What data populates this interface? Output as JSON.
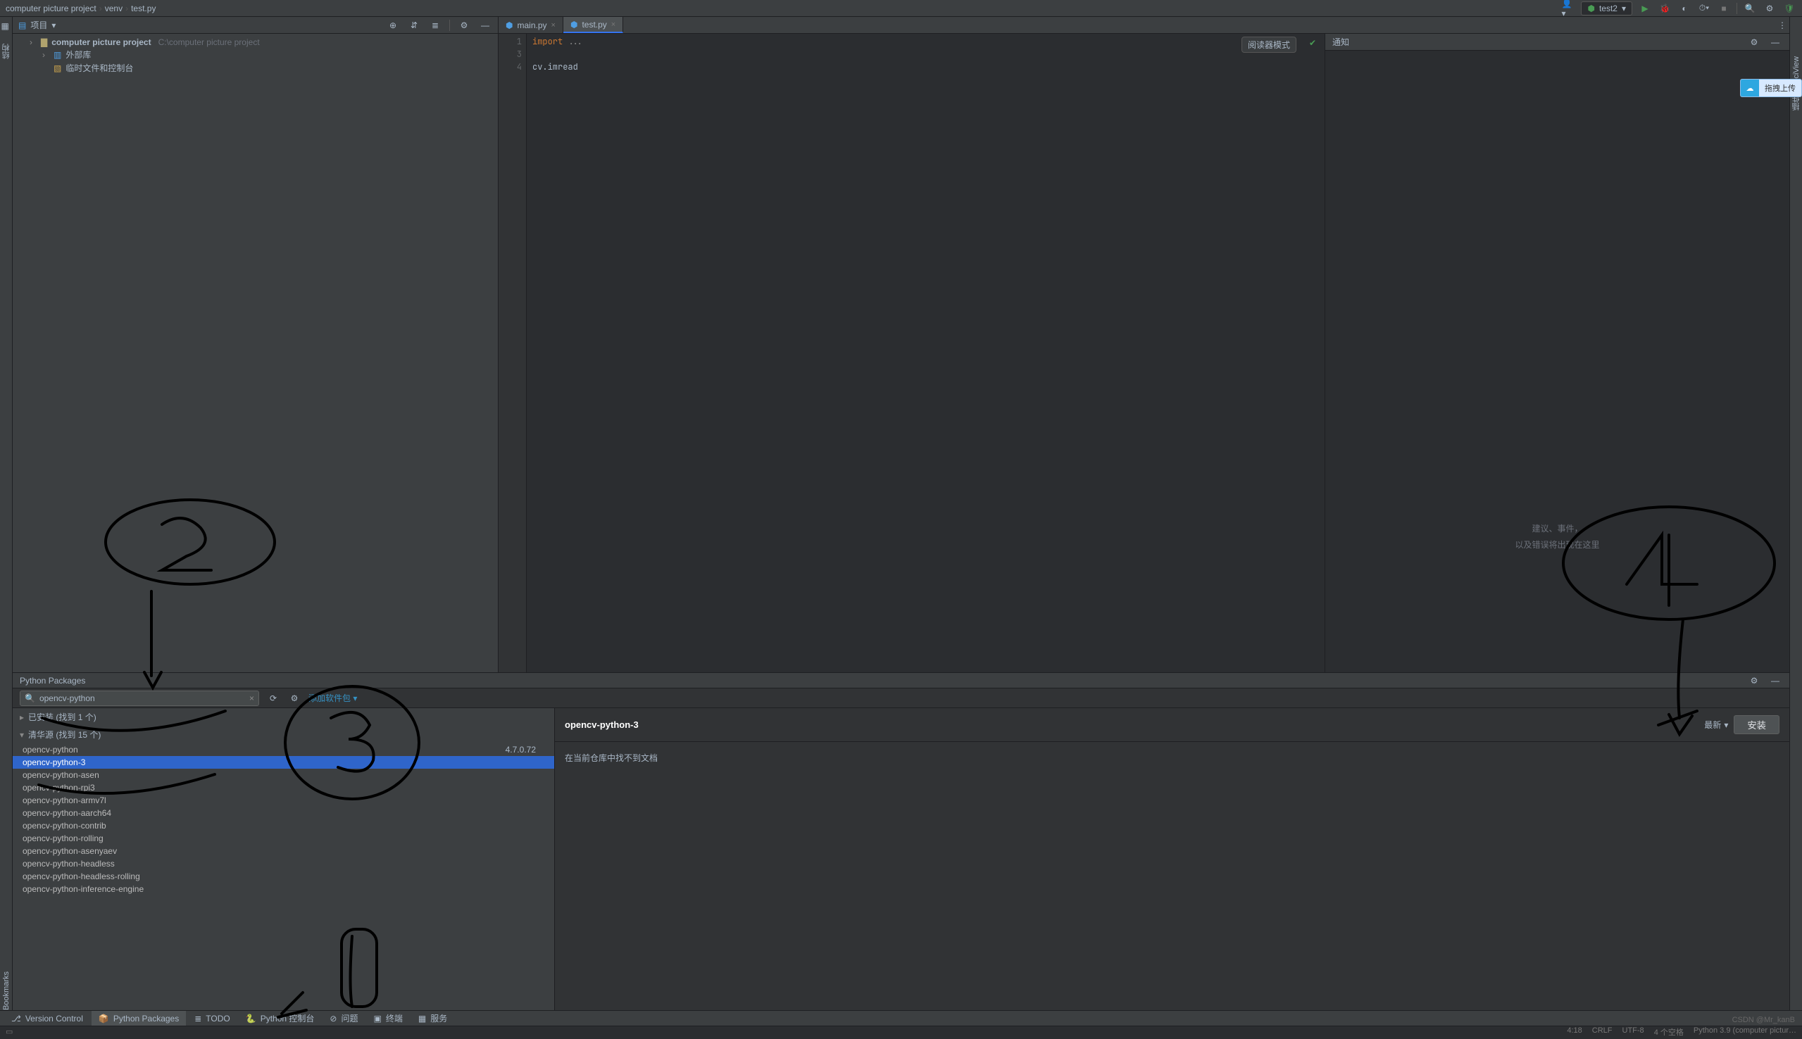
{
  "breadcrumbs": [
    "computer picture project",
    "venv",
    "test.py"
  ],
  "run_config": {
    "name": "test2"
  },
  "project_tool": {
    "title": "项目",
    "root": {
      "name": "computer picture project",
      "path": "C:\\computer picture project"
    },
    "items": [
      {
        "label": "外部库"
      },
      {
        "label": "临时文件和控制台"
      }
    ]
  },
  "editor": {
    "tabs": [
      {
        "label": "main.py",
        "active": false
      },
      {
        "label": "test.py",
        "active": true
      }
    ],
    "reader_mode": "阅读器模式",
    "lines": [
      {
        "n": 1,
        "html": "<span class='kw'>import</span> <span class='dim'>...</span>"
      },
      {
        "n": 3,
        "html": ""
      },
      {
        "n": 4,
        "html": "cv.imread"
      }
    ]
  },
  "notifications": {
    "title": "通知",
    "empty_line1": "建议、事件，",
    "empty_line2": "以及错误将出现在这里"
  },
  "side_right": {
    "tab1": "SciView",
    "tab2": "插件"
  },
  "upload_badge": "拖拽上传",
  "left_gutter": {
    "tab1": "结构",
    "tab2": "Bookmarks"
  },
  "packages_panel": {
    "title": "Python Packages",
    "search_value": "opencv-python",
    "add_label": "添加软件包",
    "groups": [
      {
        "label": "已安装 (找到 1 个)",
        "expanded": false
      },
      {
        "label": "清华源 (找到 15 个)",
        "expanded": true
      }
    ],
    "rows": [
      {
        "name": "opencv-python",
        "version": "4.7.0.72"
      },
      {
        "name": "opencv-python-3",
        "selected": true
      },
      {
        "name": "opencv-python-asen"
      },
      {
        "name": "opencv-python-rpi3"
      },
      {
        "name": "opencv-python-armv7l"
      },
      {
        "name": "opencv-python-aarch64"
      },
      {
        "name": "opencv-python-contrib"
      },
      {
        "name": "opencv-python-rolling"
      },
      {
        "name": "opencv-python-asenyaev"
      },
      {
        "name": "opencv-python-headless"
      },
      {
        "name": "opencv-python-headless-rolling"
      },
      {
        "name": "opencv-python-inference-engine"
      }
    ],
    "detail": {
      "name": "opencv-python-3",
      "version_label": "最新",
      "install_label": "安装",
      "body": "在当前仓库中找不到文档"
    }
  },
  "bottom_tabs": [
    {
      "label": "Version Control"
    },
    {
      "label": "Python Packages",
      "active": true
    },
    {
      "label": "TODO"
    },
    {
      "label": "Python 控制台"
    },
    {
      "label": "问题"
    },
    {
      "label": "终端"
    },
    {
      "label": "服务"
    }
  ],
  "status": {
    "items": [
      "4:18",
      "CRLF",
      "UTF-8",
      "4 个空格",
      "Python 3.9 (computer pictur…"
    ]
  },
  "watermark": "CSDN @Mr_kanB"
}
